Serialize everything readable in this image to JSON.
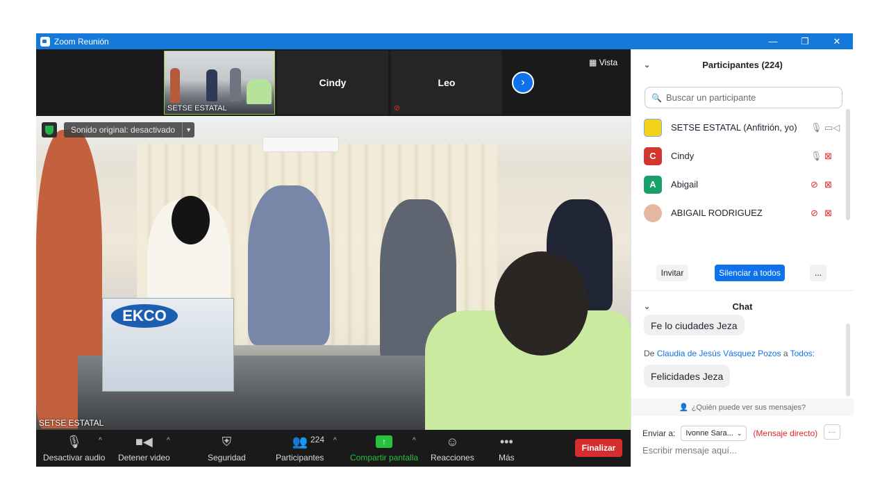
{
  "window": {
    "title": "Zoom Reunión",
    "minimize": "—",
    "restore": "❐",
    "close": "✕"
  },
  "strip": {
    "thumbs": [
      {
        "name": "",
        "label": "SETSE ESTATAL",
        "active": true
      },
      {
        "name": "Cindy",
        "label": ""
      },
      {
        "name": "Leo",
        "label": ""
      }
    ],
    "next_icon": "chevron-right-icon",
    "view_label": "Vista"
  },
  "video": {
    "sound_original": "Sonido original: desactivado",
    "speaker_label": "SETSE ESTATAL",
    "box_brand": "EKCO"
  },
  "toolbar": {
    "audio_label": "Desactivar audio",
    "video_label": "Detener video",
    "security_label": "Seguridad",
    "participants_label": "Participantes",
    "participants_count": "224",
    "share_label": "Compartir pantalla",
    "reactions_label": "Reacciones",
    "more_label": "Más",
    "end_label": "Finalizar"
  },
  "participants": {
    "header": "Participantes (224)",
    "search_placeholder": "Buscar un participante",
    "list": [
      {
        "name": "SETSE ESTATAL (Anfitrión, yo)",
        "initial": "",
        "color": "#f2d21b",
        "mic": "on",
        "video": "on"
      },
      {
        "name": "Cindy",
        "initial": "C",
        "color": "#d2372f",
        "mic": "on",
        "video": "off"
      },
      {
        "name": "Abigail",
        "initial": "A",
        "color": "#18a06b",
        "mic": "off",
        "video": "off"
      },
      {
        "name": "ABIGAIL RODRIGUEZ",
        "initial": "",
        "color": "#e6b7a0",
        "mic": "off",
        "video": "off"
      }
    ],
    "invite_label": "Invitar",
    "mute_all_label": "Silenciar a todos",
    "more_label": "..."
  },
  "chat": {
    "header": "Chat",
    "prev_message": "Fe lo ciudades Jeza",
    "from_prefix": "De",
    "sender": "Claudia de Jesús Vásquez Pozos",
    "to_word": "a",
    "recipient": "Todos:",
    "message": "Felicidades Jeza",
    "who_can_see": "¿Quién puede ver sus mensajes?",
    "send_to_label": "Enviar a:",
    "send_to_value": "Ivonne Sara...",
    "direct_label": "(Mensaje directo)",
    "more_label": "···",
    "input_placeholder": "Escribir mensaje aquí..."
  }
}
